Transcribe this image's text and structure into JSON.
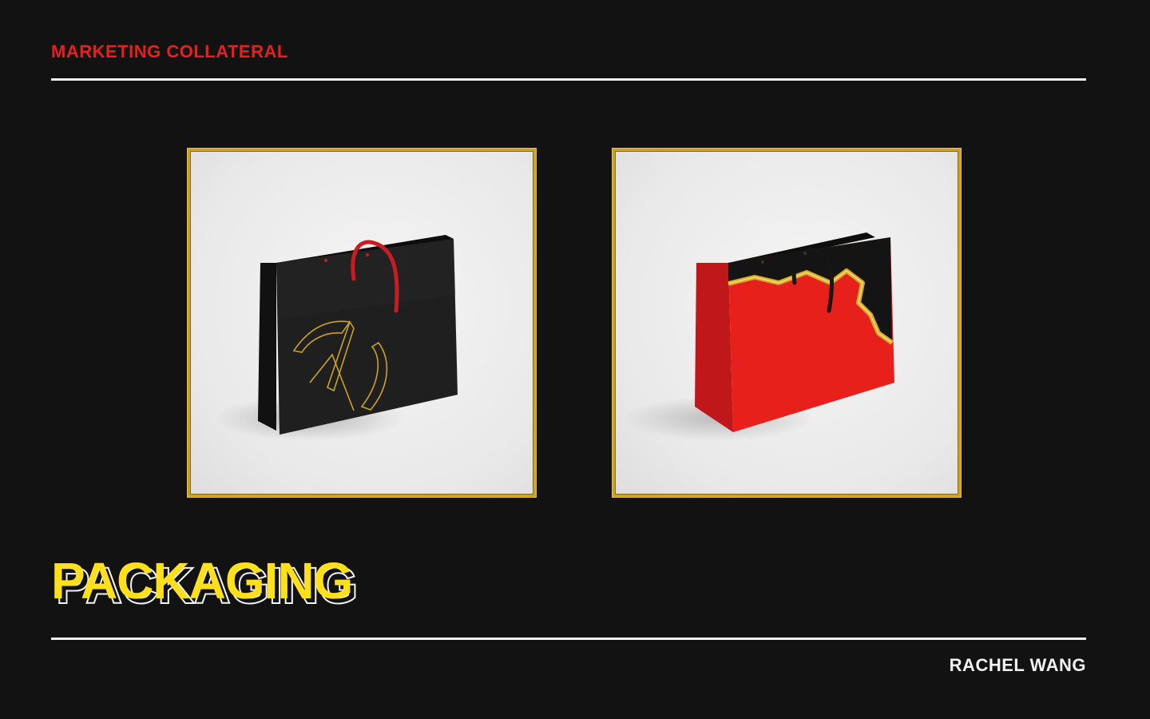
{
  "header": {
    "section_label": "MARKETING COLLATERAL"
  },
  "gallery": {
    "items": [
      {
        "name": "black-shopping-bag",
        "bag_color": "#1b1b1b",
        "handle_color": "#c81c22",
        "accent_color": "#c9a227"
      },
      {
        "name": "red-shopping-bag",
        "bag_color": "#e8201c",
        "handle_color": "#151515",
        "accent_color": "#d4a92a"
      }
    ]
  },
  "footer": {
    "title": "PACKAGING",
    "author": "RACHEL WANG"
  },
  "colors": {
    "background": "#121212",
    "accent_red": "#e8201c",
    "accent_yellow": "#ffe01a",
    "rule": "#f2f2f2",
    "gold": "#c9a227"
  }
}
